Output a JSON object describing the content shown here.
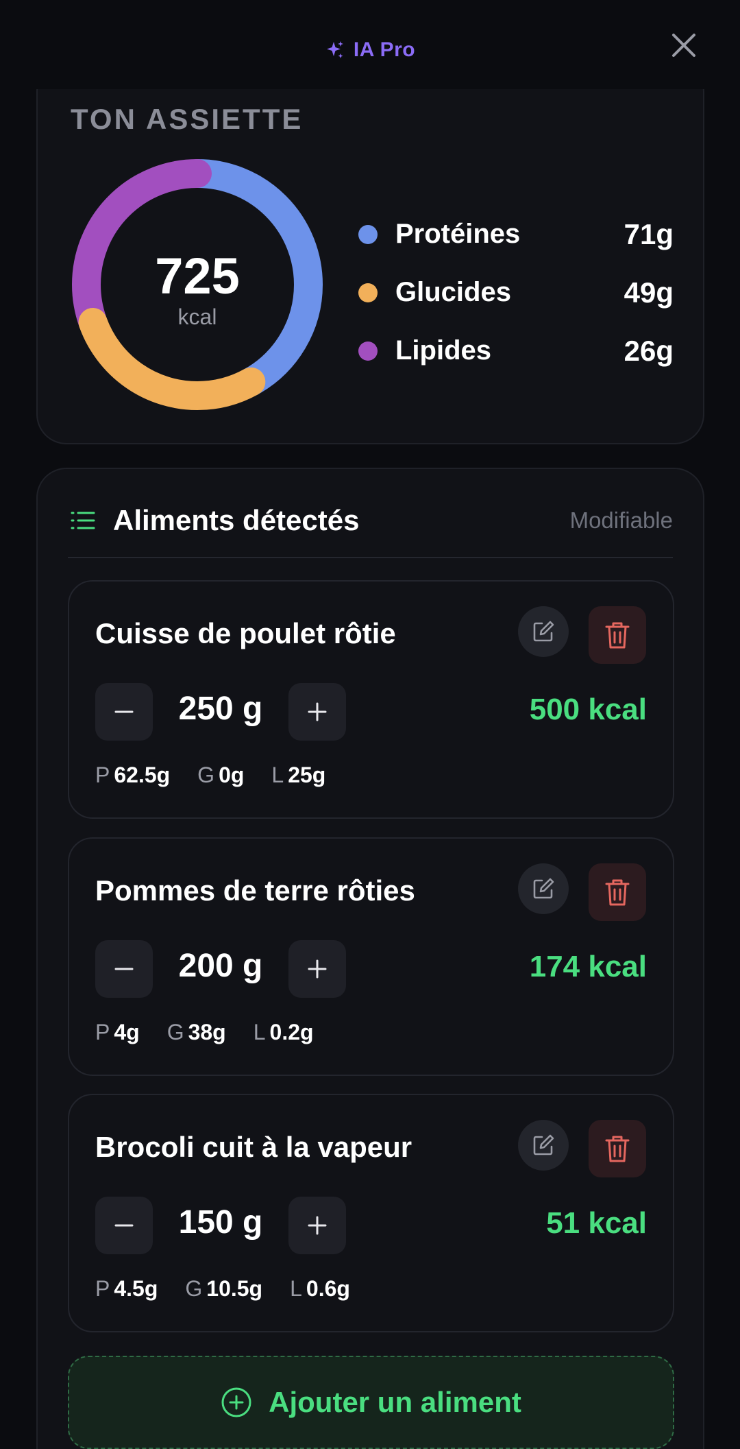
{
  "header": {
    "brand": "IA Pro"
  },
  "assiette": {
    "title": "TON ASSIETTE",
    "kcal_value": "725",
    "kcal_unit": "kcal",
    "macros": [
      {
        "label": "Protéines",
        "value": "71g",
        "color": "#6d92ea"
      },
      {
        "label": "Glucides",
        "value": "49g",
        "color": "#f2b05a"
      },
      {
        "label": "Lipides",
        "value": "26g",
        "color": "#a24fbf"
      }
    ]
  },
  "aliments": {
    "title": "Aliments détectés",
    "badge": "Modifiable",
    "items": [
      {
        "name": "Cuisse de poulet rôtie",
        "qty": "250 g",
        "kcal": "500 kcal",
        "p_key": "P",
        "p_val": "62.5g",
        "g_key": "G",
        "g_val": "0g",
        "l_key": "L",
        "l_val": "25g"
      },
      {
        "name": "Pommes de terre rôties",
        "qty": "200 g",
        "kcal": "174 kcal",
        "p_key": "P",
        "p_val": "4g",
        "g_key": "G",
        "g_val": "38g",
        "l_key": "L",
        "l_val": "0.2g"
      },
      {
        "name": "Brocoli cuit à la vapeur",
        "qty": "150 g",
        "kcal": "51 kcal",
        "p_key": "P",
        "p_val": "4.5g",
        "g_key": "G",
        "g_val": "10.5g",
        "l_key": "L",
        "l_val": "0.6g"
      }
    ],
    "add_label": "Ajouter un aliment"
  },
  "colors": {
    "accent_green": "#4ade80",
    "brand_purple": "#8b6cf6",
    "danger": "#e5675f"
  }
}
